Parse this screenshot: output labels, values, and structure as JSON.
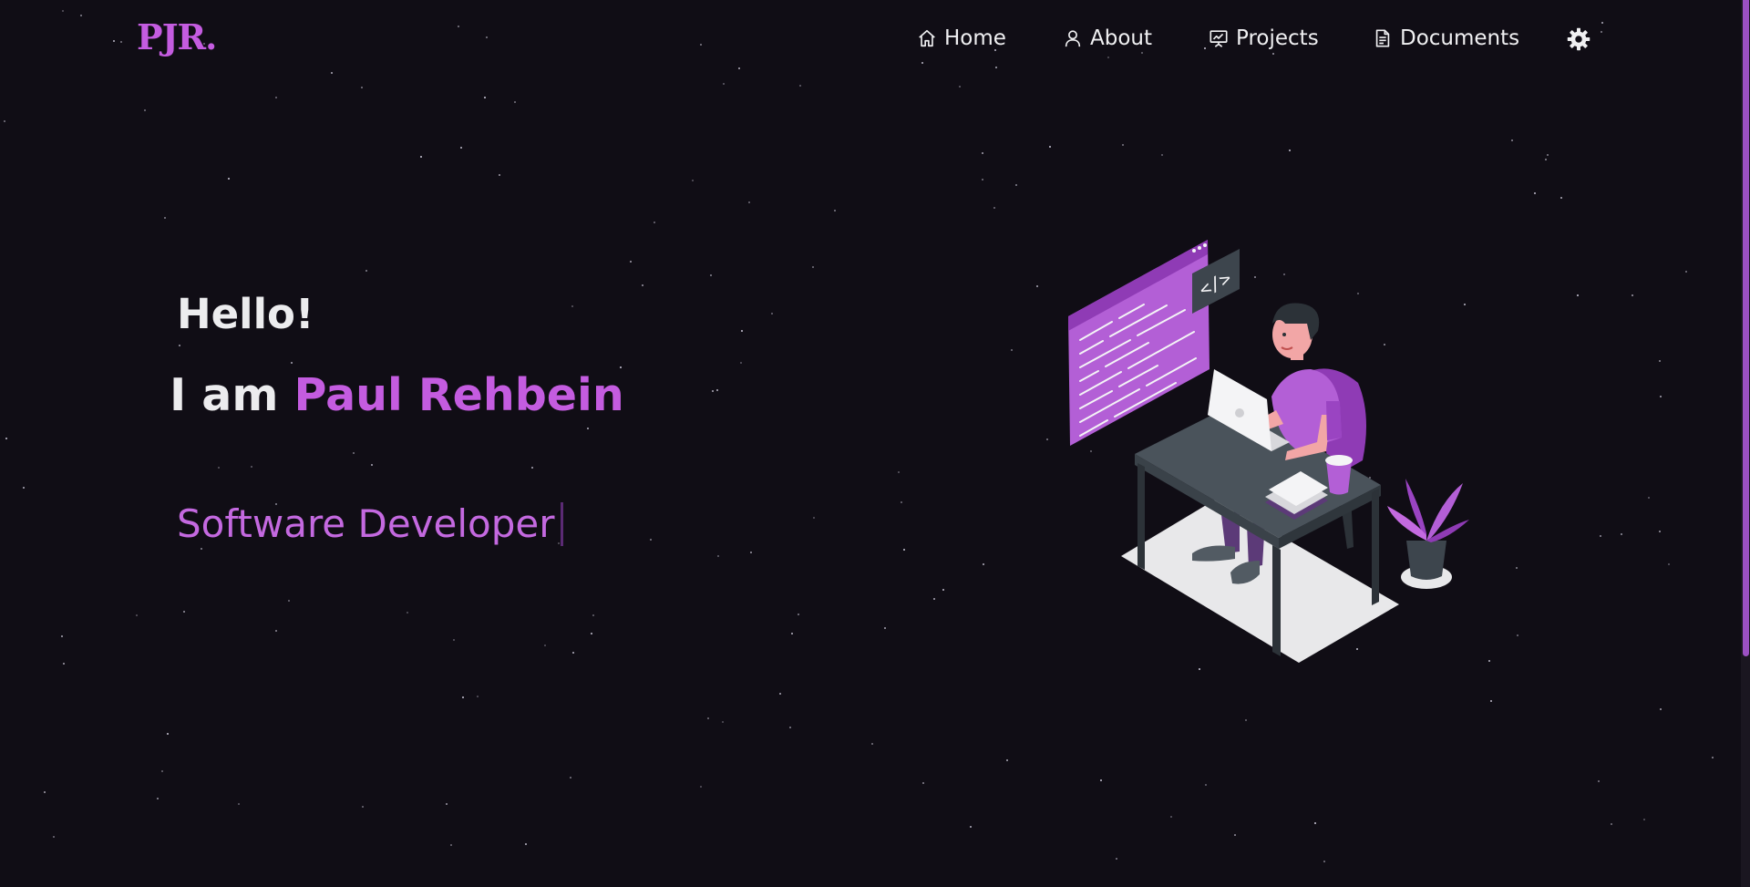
{
  "logo": "PJR.",
  "nav": {
    "home": "Home",
    "about": "About",
    "projects": "Projects",
    "documents": "Documents"
  },
  "hero": {
    "greeting": "Hello!",
    "intro_prefix": "I am ",
    "name": "Paul Rehbein",
    "role": "Software Developer"
  },
  "illustration": {
    "code_tag": "</>"
  },
  "colors": {
    "background": "#100d15",
    "accent": "#c45ce0",
    "text": "#ececee"
  },
  "icons": [
    "home-icon",
    "user-icon",
    "presentation-icon",
    "document-icon",
    "gear-icon"
  ]
}
